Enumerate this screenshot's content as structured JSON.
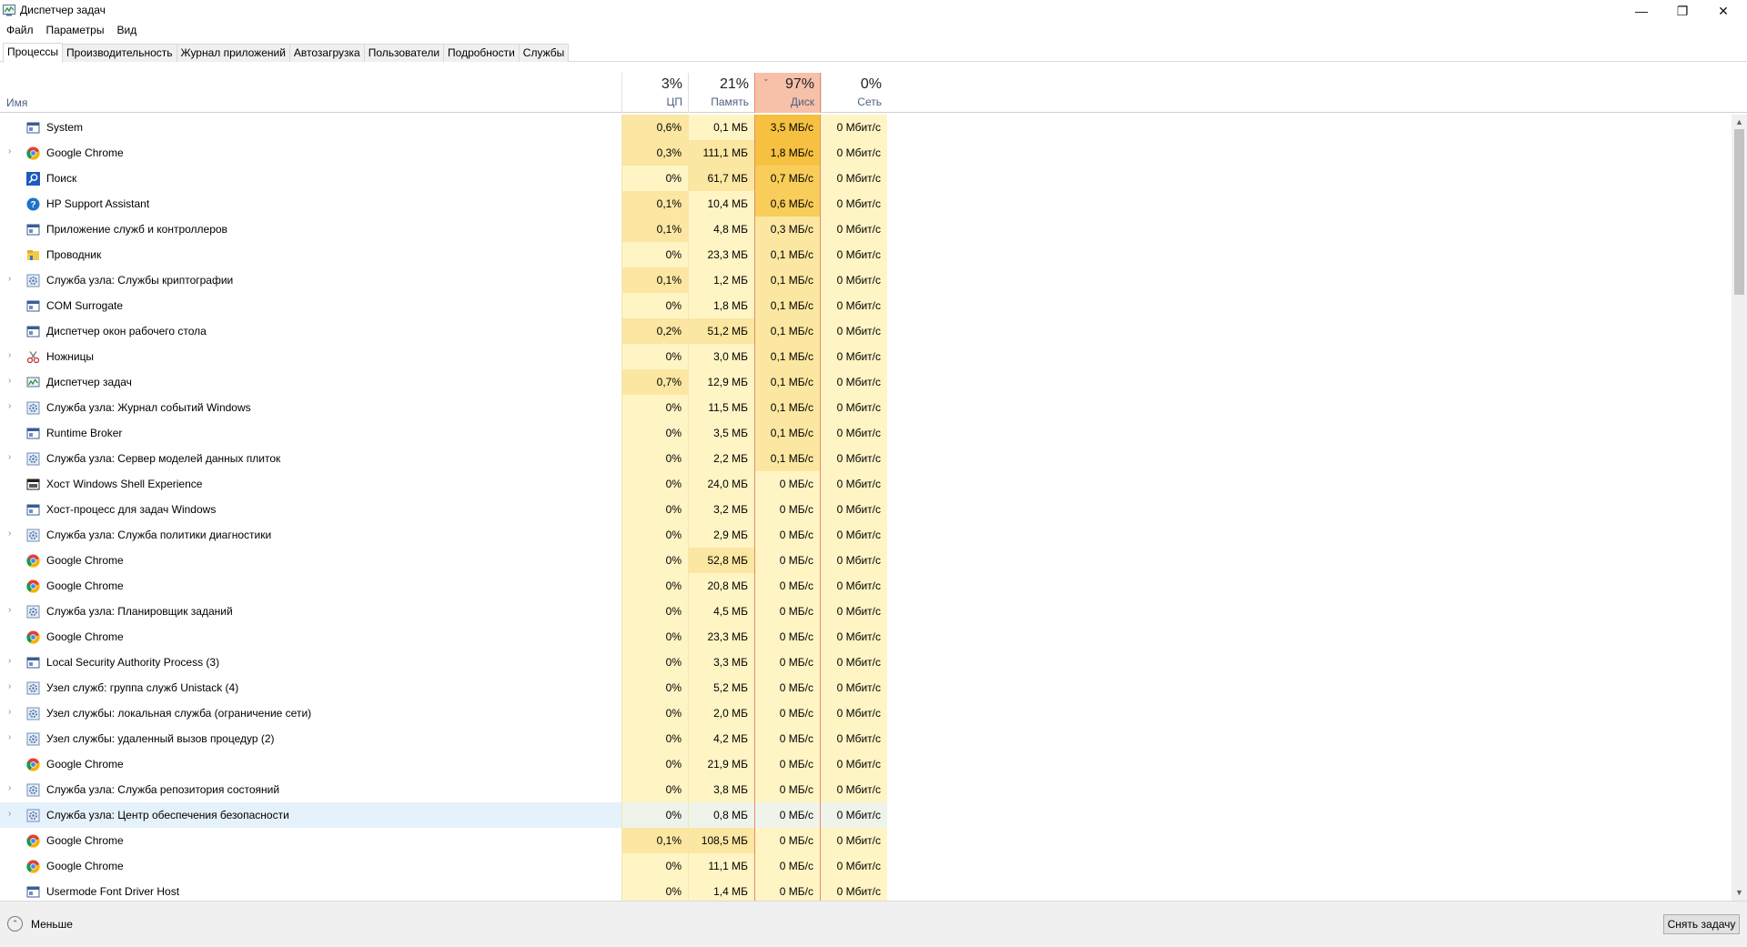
{
  "window": {
    "title": "Диспетчер задач",
    "minimize": "—",
    "maximize": "❐",
    "close": "✕"
  },
  "menu": [
    "Файл",
    "Параметры",
    "Вид"
  ],
  "tabs": [
    "Процессы",
    "Производительность",
    "Журнал приложений",
    "Автозагрузка",
    "Пользователи",
    "Подробности",
    "Службы"
  ],
  "active_tab": 0,
  "columns": {
    "name": "Имя",
    "cpu": {
      "pct": "3%",
      "label": "ЦП"
    },
    "memory": {
      "pct": "21%",
      "label": "Память"
    },
    "disk": {
      "pct": "97%",
      "label": "Диск"
    },
    "network": {
      "pct": "0%",
      "label": "Сеть"
    }
  },
  "colors": {
    "heat_light": "#fff4c4",
    "heat_mid": "#fbe7a1",
    "heat_orange": "#f8cd5a",
    "heat_strong": "#f6c141",
    "disk_header": "#f7c0a9",
    "selection": "#e5f1fb"
  },
  "processes": [
    {
      "name": "System",
      "icon": "window-icon",
      "expand": false,
      "cpu": "0,6%",
      "mem": "0,1 МБ",
      "disk": "3,5 МБ/с",
      "net": "0 Мбит/с",
      "cpuLevel": 1,
      "memLevel": 0,
      "diskLevel": 3
    },
    {
      "name": "Google Chrome",
      "icon": "chrome-icon",
      "expand": true,
      "cpu": "0,3%",
      "mem": "111,1 МБ",
      "disk": "1,8 МБ/с",
      "net": "0 Мбит/с",
      "cpuLevel": 1,
      "memLevel": 1,
      "diskLevel": 3
    },
    {
      "name": "Поиск",
      "icon": "search-icon",
      "expand": false,
      "cpu": "0%",
      "mem": "61,7 МБ",
      "disk": "0,7 МБ/с",
      "net": "0 Мбит/с",
      "cpuLevel": 0,
      "memLevel": 1,
      "diskLevel": 2
    },
    {
      "name": "HP Support Assistant",
      "icon": "help-icon",
      "expand": false,
      "cpu": "0,1%",
      "mem": "10,4 МБ",
      "disk": "0,6 МБ/с",
      "net": "0 Мбит/с",
      "cpuLevel": 1,
      "memLevel": 0,
      "diskLevel": 2
    },
    {
      "name": "Приложение служб и контроллеров",
      "icon": "window-icon",
      "expand": false,
      "cpu": "0,1%",
      "mem": "4,8 МБ",
      "disk": "0,3 МБ/с",
      "net": "0 Мбит/с",
      "cpuLevel": 1,
      "memLevel": 0,
      "diskLevel": 1
    },
    {
      "name": "Проводник",
      "icon": "folder-icon",
      "expand": false,
      "cpu": "0%",
      "mem": "23,3 МБ",
      "disk": "0,1 МБ/с",
      "net": "0 Мбит/с",
      "cpuLevel": 0,
      "memLevel": 0,
      "diskLevel": 1
    },
    {
      "name": "Служба узла: Службы криптографии",
      "icon": "gear-icon",
      "expand": true,
      "cpu": "0,1%",
      "mem": "1,2 МБ",
      "disk": "0,1 МБ/с",
      "net": "0 Мбит/с",
      "cpuLevel": 1,
      "memLevel": 0,
      "diskLevel": 1
    },
    {
      "name": "COM Surrogate",
      "icon": "window-icon",
      "expand": false,
      "cpu": "0%",
      "mem": "1,8 МБ",
      "disk": "0,1 МБ/с",
      "net": "0 Мбит/с",
      "cpuLevel": 0,
      "memLevel": 0,
      "diskLevel": 1
    },
    {
      "name": "Диспетчер окон рабочего стола",
      "icon": "window-icon",
      "expand": false,
      "cpu": "0,2%",
      "mem": "51,2 МБ",
      "disk": "0,1 МБ/с",
      "net": "0 Мбит/с",
      "cpuLevel": 1,
      "memLevel": 1,
      "diskLevel": 1
    },
    {
      "name": "Ножницы",
      "icon": "scissors-icon",
      "expand": true,
      "cpu": "0%",
      "mem": "3,0 МБ",
      "disk": "0,1 МБ/с",
      "net": "0 Мбит/с",
      "cpuLevel": 0,
      "memLevel": 0,
      "diskLevel": 1
    },
    {
      "name": "Диспетчер задач",
      "icon": "taskmgr-icon",
      "expand": true,
      "cpu": "0,7%",
      "mem": "12,9 МБ",
      "disk": "0,1 МБ/с",
      "net": "0 Мбит/с",
      "cpuLevel": 1,
      "memLevel": 0,
      "diskLevel": 1
    },
    {
      "name": "Служба узла: Журнал событий Windows",
      "icon": "gear-icon",
      "expand": true,
      "cpu": "0%",
      "mem": "11,5 МБ",
      "disk": "0,1 МБ/с",
      "net": "0 Мбит/с",
      "cpuLevel": 0,
      "memLevel": 0,
      "diskLevel": 1
    },
    {
      "name": "Runtime Broker",
      "icon": "window-icon",
      "expand": false,
      "cpu": "0%",
      "mem": "3,5 МБ",
      "disk": "0,1 МБ/с",
      "net": "0 Мбит/с",
      "cpuLevel": 0,
      "memLevel": 0,
      "diskLevel": 1
    },
    {
      "name": "Служба узла: Сервер моделей данных плиток",
      "icon": "gear-icon",
      "expand": true,
      "cpu": "0%",
      "mem": "2,2 МБ",
      "disk": "0,1 МБ/с",
      "net": "0 Мбит/с",
      "cpuLevel": 0,
      "memLevel": 0,
      "diskLevel": 1
    },
    {
      "name": "Хост Windows Shell Experience",
      "icon": "dark-window-icon",
      "expand": false,
      "cpu": "0%",
      "mem": "24,0 МБ",
      "disk": "0 МБ/с",
      "net": "0 Мбит/с",
      "cpuLevel": 0,
      "memLevel": 0,
      "diskLevel": 0
    },
    {
      "name": "Хост-процесс для задач Windows",
      "icon": "window-icon",
      "expand": false,
      "cpu": "0%",
      "mem": "3,2 МБ",
      "disk": "0 МБ/с",
      "net": "0 Мбит/с",
      "cpuLevel": 0,
      "memLevel": 0,
      "diskLevel": 0
    },
    {
      "name": "Служба узла: Служба политики диагностики",
      "icon": "gear-icon",
      "expand": true,
      "cpu": "0%",
      "mem": "2,9 МБ",
      "disk": "0 МБ/с",
      "net": "0 Мбит/с",
      "cpuLevel": 0,
      "memLevel": 0,
      "diskLevel": 0
    },
    {
      "name": "Google Chrome",
      "icon": "chrome-icon",
      "expand": false,
      "cpu": "0%",
      "mem": "52,8 МБ",
      "disk": "0 МБ/с",
      "net": "0 Мбит/с",
      "cpuLevel": 0,
      "memLevel": 1,
      "diskLevel": 0
    },
    {
      "name": "Google Chrome",
      "icon": "chrome-icon",
      "expand": false,
      "cpu": "0%",
      "mem": "20,8 МБ",
      "disk": "0 МБ/с",
      "net": "0 Мбит/с",
      "cpuLevel": 0,
      "memLevel": 0,
      "diskLevel": 0
    },
    {
      "name": "Служба узла: Планировщик заданий",
      "icon": "gear-icon",
      "expand": true,
      "cpu": "0%",
      "mem": "4,5 МБ",
      "disk": "0 МБ/с",
      "net": "0 Мбит/с",
      "cpuLevel": 0,
      "memLevel": 0,
      "diskLevel": 0
    },
    {
      "name": "Google Chrome",
      "icon": "chrome-icon",
      "expand": false,
      "cpu": "0%",
      "mem": "23,3 МБ",
      "disk": "0 МБ/с",
      "net": "0 Мбит/с",
      "cpuLevel": 0,
      "memLevel": 0,
      "diskLevel": 0
    },
    {
      "name": "Local Security Authority Process (3)",
      "icon": "window-icon",
      "expand": true,
      "cpu": "0%",
      "mem": "3,3 МБ",
      "disk": "0 МБ/с",
      "net": "0 Мбит/с",
      "cpuLevel": 0,
      "memLevel": 0,
      "diskLevel": 0
    },
    {
      "name": "Узел служб: группа служб Unistack (4)",
      "icon": "gear-icon",
      "expand": true,
      "cpu": "0%",
      "mem": "5,2 МБ",
      "disk": "0 МБ/с",
      "net": "0 Мбит/с",
      "cpuLevel": 0,
      "memLevel": 0,
      "diskLevel": 0
    },
    {
      "name": "Узел службы: локальная служба (ограничение сети)",
      "icon": "gear-icon",
      "expand": true,
      "cpu": "0%",
      "mem": "2,0 МБ",
      "disk": "0 МБ/с",
      "net": "0 Мбит/с",
      "cpuLevel": 0,
      "memLevel": 0,
      "diskLevel": 0
    },
    {
      "name": "Узел службы: удаленный вызов процедур (2)",
      "icon": "gear-icon",
      "expand": true,
      "cpu": "0%",
      "mem": "4,2 МБ",
      "disk": "0 МБ/с",
      "net": "0 Мбит/с",
      "cpuLevel": 0,
      "memLevel": 0,
      "diskLevel": 0
    },
    {
      "name": "Google Chrome",
      "icon": "chrome-icon",
      "expand": false,
      "cpu": "0%",
      "mem": "21,9 МБ",
      "disk": "0 МБ/с",
      "net": "0 Мбит/с",
      "cpuLevel": 0,
      "memLevel": 0,
      "diskLevel": 0
    },
    {
      "name": "Служба узла: Служба репозитория состояний",
      "icon": "gear-icon",
      "expand": true,
      "cpu": "0%",
      "mem": "3,8 МБ",
      "disk": "0 МБ/с",
      "net": "0 Мбит/с",
      "cpuLevel": 0,
      "memLevel": 0,
      "diskLevel": 0
    },
    {
      "name": "Служба узла: Центр обеспечения безопасности",
      "icon": "gear-icon",
      "expand": true,
      "cpu": "0%",
      "mem": "0,8 МБ",
      "disk": "0 МБ/с",
      "net": "0 Мбит/с",
      "cpuLevel": 0,
      "memLevel": 0,
      "diskLevel": 0,
      "selected": true
    },
    {
      "name": "Google Chrome",
      "icon": "chrome-icon",
      "expand": false,
      "cpu": "0,1%",
      "mem": "108,5 МБ",
      "disk": "0 МБ/с",
      "net": "0 Мбит/с",
      "cpuLevel": 1,
      "memLevel": 1,
      "diskLevel": 0
    },
    {
      "name": "Google Chrome",
      "icon": "chrome-icon",
      "expand": false,
      "cpu": "0%",
      "mem": "11,1 МБ",
      "disk": "0 МБ/с",
      "net": "0 Мбит/с",
      "cpuLevel": 0,
      "memLevel": 0,
      "diskLevel": 0
    },
    {
      "name": "Usermode Font Driver Host",
      "icon": "window-icon",
      "expand": false,
      "cpu": "0%",
      "mem": "1,4 МБ",
      "disk": "0 МБ/с",
      "net": "0 Мбит/с",
      "cpuLevel": 0,
      "memLevel": 0,
      "diskLevel": 0
    }
  ],
  "footer": {
    "fewer_label": "Меньше",
    "end_task_label": "Снять задачу"
  }
}
